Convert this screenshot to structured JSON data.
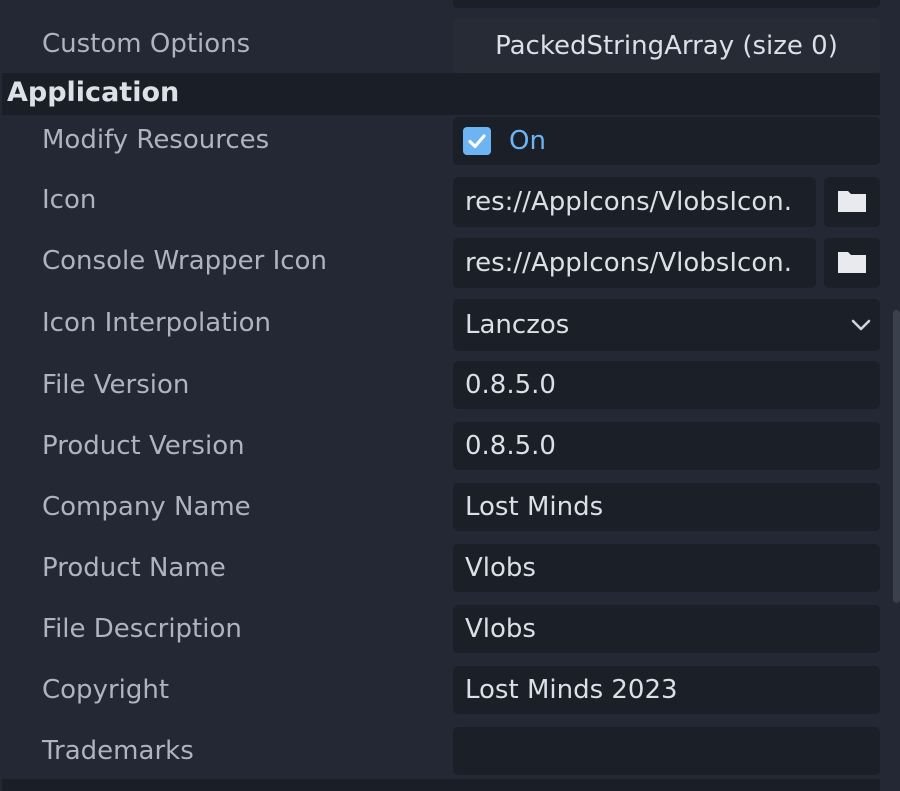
{
  "custom_options": {
    "label": "Custom Options",
    "value": "PackedStringArray (size 0)"
  },
  "application": {
    "section_title": "Application",
    "modify_resources": {
      "label": "Modify Resources",
      "checked": true,
      "state_text": "On"
    },
    "icon": {
      "label": "Icon",
      "value": "res://AppIcons/VlobsIcon."
    },
    "console_wrapper_icon": {
      "label": "Console Wrapper Icon",
      "value": "res://AppIcons/VlobsIcon."
    },
    "icon_interpolation": {
      "label": "Icon Interpolation",
      "value": "Lanczos"
    },
    "file_version": {
      "label": "File Version",
      "value": "0.8.5.0"
    },
    "product_version": {
      "label": "Product Version",
      "value": "0.8.5.0"
    },
    "company_name": {
      "label": "Company Name",
      "value": "Lost Minds"
    },
    "product_name": {
      "label": "Product Name",
      "value": "Vlobs"
    },
    "file_description": {
      "label": "File Description",
      "value": "Vlobs"
    },
    "copyright": {
      "label": "Copyright",
      "value": "Lost Minds 2023"
    },
    "trademarks": {
      "label": "Trademarks",
      "value": ""
    }
  },
  "colors": {
    "background": "#232834",
    "field": "#1b1f27",
    "accent": "#6cb4f2",
    "label": "#aeb3bd",
    "value": "#dcdfe5"
  },
  "icons": [
    "checkbox-checked-icon",
    "folder-icon",
    "chevron-down-icon"
  ]
}
